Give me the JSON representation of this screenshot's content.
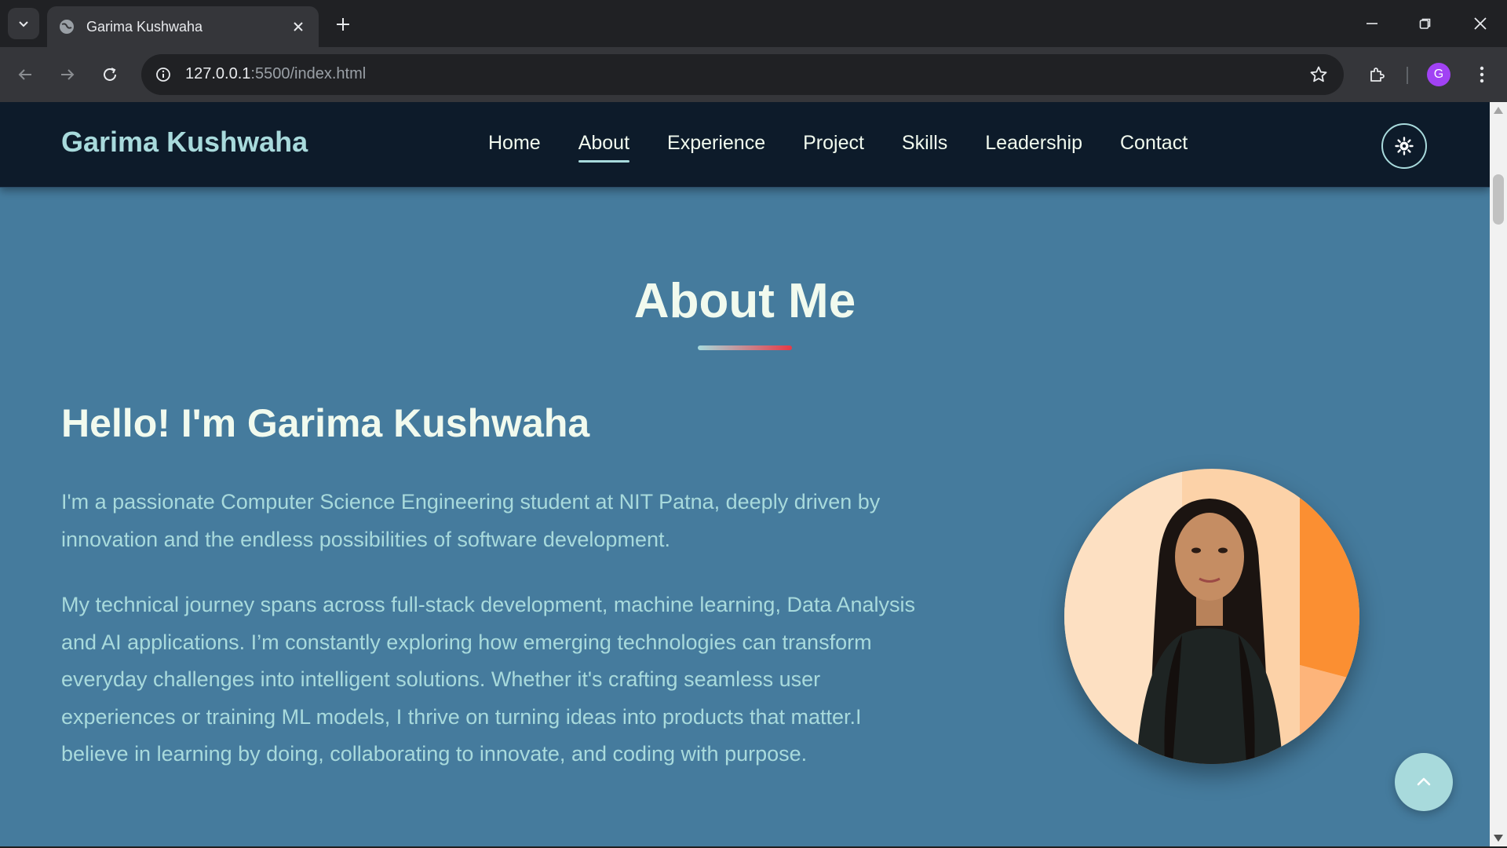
{
  "browser": {
    "tab_title": "Garima Kushwaha",
    "url_host": "127.0.0.1",
    "url_rest": ":5500/index.html",
    "profile_initial": "G"
  },
  "site": {
    "brand": "Garima Kushwaha",
    "nav": [
      {
        "label": "Home",
        "active": false
      },
      {
        "label": "About",
        "active": true
      },
      {
        "label": "Experience",
        "active": false
      },
      {
        "label": "Project",
        "active": false
      },
      {
        "label": "Skills",
        "active": false
      },
      {
        "label": "Leadership",
        "active": false
      },
      {
        "label": "Contact",
        "active": false
      }
    ],
    "theme_toggle_icon": "sun-icon"
  },
  "about": {
    "section_title": "About Me",
    "heading": "Hello! I'm Garima Kushwaha",
    "paragraph_1": "I'm a passionate Computer Science Engineering student at NIT Patna, deeply driven by innovation and the endless possibilities of software development.",
    "paragraph_2": "My technical journey spans across full-stack development, machine learning, Data Analysis and AI applications. I’m constantly exploring how emerging technologies can transform everyday challenges into intelligent solutions. Whether it's crafting seamless user experiences or training ML models, I thrive on turning ideas into products that matter.I believe in learning by doing, collaborating to innovate, and coding with purpose."
  },
  "colors": {
    "page_bg": "#457b9d",
    "nav_bg": "#0d1b2a",
    "accent": "#a8dadc",
    "highlight": "#e63946",
    "text_light": "#f1faee"
  }
}
